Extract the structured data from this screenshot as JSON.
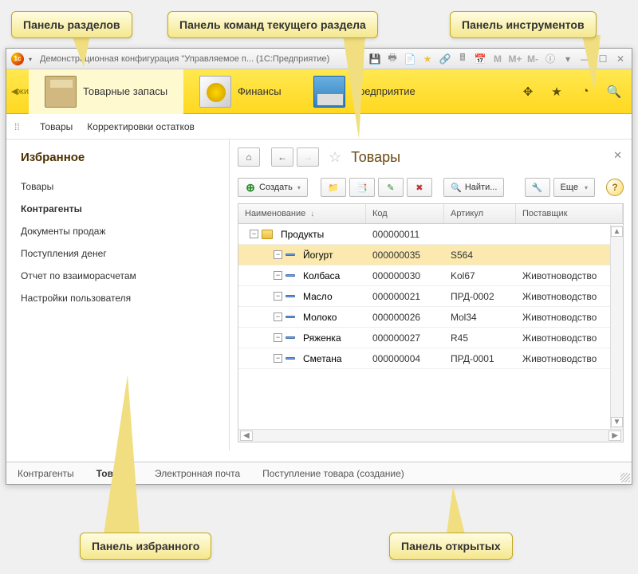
{
  "callouts": {
    "sections": "Панель разделов",
    "commands": "Панель команд текущего раздела",
    "tools": "Панель инструментов",
    "favorites": "Панель избранного",
    "open": "Панель открытых"
  },
  "titlebar": {
    "text": "Демонстрационная конфигурация \"Управляемое п...    (1С:Предприятие)",
    "letters": {
      "m": "M",
      "mp": "M+",
      "mm": "M-"
    }
  },
  "sections": {
    "left_hint": "жи",
    "items": [
      {
        "label": "Товарные запасы"
      },
      {
        "label": "Финансы"
      },
      {
        "label": "Предприятие"
      }
    ]
  },
  "commands": {
    "items": [
      "Товары",
      "Корректировки остатков"
    ]
  },
  "favorites": {
    "title": "Избранное",
    "items": [
      "Товары",
      "Контрагенты",
      "Документы продаж",
      "Поступления денег",
      "Отчет по взаиморасчетам",
      "Настройки пользователя"
    ],
    "active_index": 1
  },
  "page": {
    "title": "Товары"
  },
  "toolbar": {
    "create": "Создать",
    "find": "Найти...",
    "more": "Еще"
  },
  "grid": {
    "columns": {
      "name": "Наименование",
      "code": "Код",
      "article": "Артикул",
      "supplier": "Поставщик"
    },
    "rows": [
      {
        "name": "Продукты",
        "code": "000000011",
        "article": "",
        "supplier": "",
        "folder": true,
        "level": 1
      },
      {
        "name": "Йогурт",
        "code": "000000035",
        "article": "S564",
        "supplier": "",
        "folder": false,
        "level": 2,
        "selected": true
      },
      {
        "name": "Колбаса",
        "code": "000000030",
        "article": "Kol67",
        "supplier": "Животноводство",
        "folder": false,
        "level": 2
      },
      {
        "name": "Масло",
        "code": "000000021",
        "article": "ПРД-0002",
        "supplier": "Животноводство",
        "folder": false,
        "level": 2
      },
      {
        "name": "Молоко",
        "code": "000000026",
        "article": "Mol34",
        "supplier": "Животноводство",
        "folder": false,
        "level": 2
      },
      {
        "name": "Ряженка",
        "code": "000000027",
        "article": "R45",
        "supplier": "Животноводство",
        "folder": false,
        "level": 2
      },
      {
        "name": "Сметана",
        "code": "000000004",
        "article": "ПРД-0001",
        "supplier": "Животноводство",
        "folder": false,
        "level": 2
      }
    ]
  },
  "open_tabs": {
    "items": [
      "Контрагенты",
      "Товары",
      "Электронная почта",
      "Поступление товара (создание)"
    ],
    "active_index": 1
  }
}
